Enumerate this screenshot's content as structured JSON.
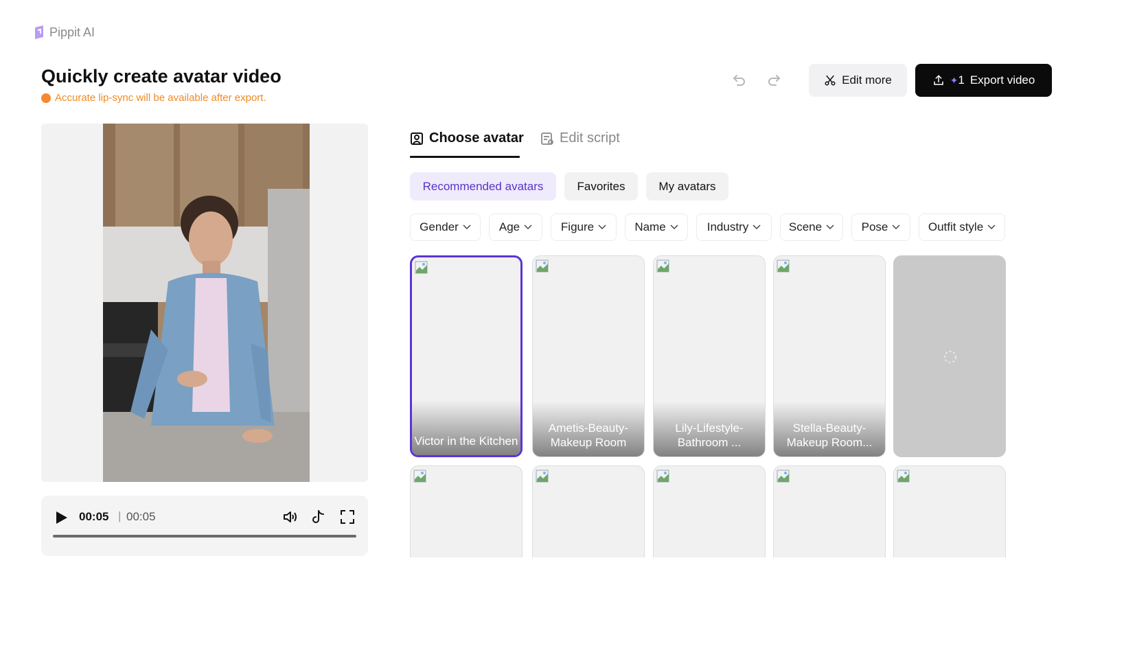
{
  "app": {
    "logo_text": "Pippit AI"
  },
  "header": {
    "title": "Quickly create avatar video",
    "notice": "Accurate lip-sync will be available after export.",
    "edit_more_label": "Edit more",
    "export_count": "1",
    "export_label": "Export video"
  },
  "player": {
    "current_time": "00:05",
    "separator": "|",
    "total_time": "00:05",
    "progress": 1.0
  },
  "tabs": [
    {
      "label": "Choose avatar",
      "active": true
    },
    {
      "label": "Edit script",
      "active": false
    }
  ],
  "avatar_categories": [
    {
      "label": "Recommended avatars",
      "active": true
    },
    {
      "label": "Favorites",
      "active": false
    },
    {
      "label": "My avatars",
      "active": false
    }
  ],
  "filters": [
    "Gender",
    "Age",
    "Figure",
    "Name",
    "Industry",
    "Scene",
    "Pose",
    "Outfit style"
  ],
  "avatars": [
    {
      "caption": "Victor in the Kitchen",
      "selected": true
    },
    {
      "caption": "Ametis-Beauty-Makeup Room",
      "selected": false
    },
    {
      "caption": "Lily-Lifestyle-Bathroom ...",
      "selected": false
    },
    {
      "caption": "Stella-Beauty-Makeup Room...",
      "selected": false
    },
    {
      "caption": "",
      "loading": true
    }
  ],
  "colors": {
    "accent": "#5b35d5",
    "notice": "#f08a24",
    "export_bg": "#0b0b0b",
    "chip_active_bg": "#efeafc"
  },
  "icons": [
    "logo-icon",
    "undo-icon",
    "redo-icon",
    "scissors-icon",
    "upload-icon",
    "sparkle-icon",
    "avatar-icon",
    "script-icon",
    "play-icon",
    "volume-icon",
    "tiktok-icon",
    "fullscreen-icon",
    "chevron-down-icon",
    "broken-image-icon",
    "spinner-icon"
  ]
}
